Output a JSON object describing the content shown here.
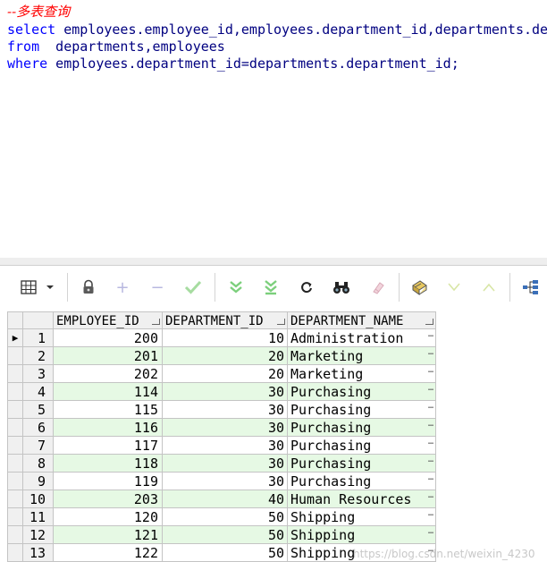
{
  "editor": {
    "comment": "--多表查询",
    "line1_kw": "select",
    "line1_rest": " employees.employee_id,employees.department_id,departments.department_name",
    "line2_kw": "from",
    "line2_rest": "  departments,employees",
    "line3_kw": "where",
    "line3_rest": " employees.department_id=departments.department_id;"
  },
  "toolbar": {
    "icons": [
      "grid-icon",
      "dropdown-arrow-icon",
      "lock-icon",
      "add-icon",
      "remove-icon",
      "post-icon",
      "fetch-next-icon",
      "fetch-all-icon",
      "refresh-icon",
      "find-icon",
      "clear-icon",
      "query-by-example-icon",
      "next-record-icon",
      "previous-record-icon",
      "export-icon"
    ]
  },
  "grid": {
    "headers": {
      "employee_id": "EMPLOYEE_ID",
      "department_id": "DEPARTMENT_ID",
      "department_name": "DEPARTMENT_NAME"
    },
    "current_row_marker": "▶",
    "ellipsis": "…",
    "rows": [
      {
        "n": "1",
        "employee_id": "200",
        "department_id": "10",
        "department_name": "Administration"
      },
      {
        "n": "2",
        "employee_id": "201",
        "department_id": "20",
        "department_name": "Marketing"
      },
      {
        "n": "3",
        "employee_id": "202",
        "department_id": "20",
        "department_name": "Marketing"
      },
      {
        "n": "4",
        "employee_id": "114",
        "department_id": "30",
        "department_name": "Purchasing"
      },
      {
        "n": "5",
        "employee_id": "115",
        "department_id": "30",
        "department_name": "Purchasing"
      },
      {
        "n": "6",
        "employee_id": "116",
        "department_id": "30",
        "department_name": "Purchasing"
      },
      {
        "n": "7",
        "employee_id": "117",
        "department_id": "30",
        "department_name": "Purchasing"
      },
      {
        "n": "8",
        "employee_id": "118",
        "department_id": "30",
        "department_name": "Purchasing"
      },
      {
        "n": "9",
        "employee_id": "119",
        "department_id": "30",
        "department_name": "Purchasing"
      },
      {
        "n": "10",
        "employee_id": "203",
        "department_id": "40",
        "department_name": "Human Resources"
      },
      {
        "n": "11",
        "employee_id": "120",
        "department_id": "50",
        "department_name": "Shipping"
      },
      {
        "n": "12",
        "employee_id": "121",
        "department_id": "50",
        "department_name": "Shipping"
      },
      {
        "n": "13",
        "employee_id": "122",
        "department_id": "50",
        "department_name": "Shipping"
      }
    ]
  },
  "watermark": "https://blog.csdn.net/weixin_4230"
}
